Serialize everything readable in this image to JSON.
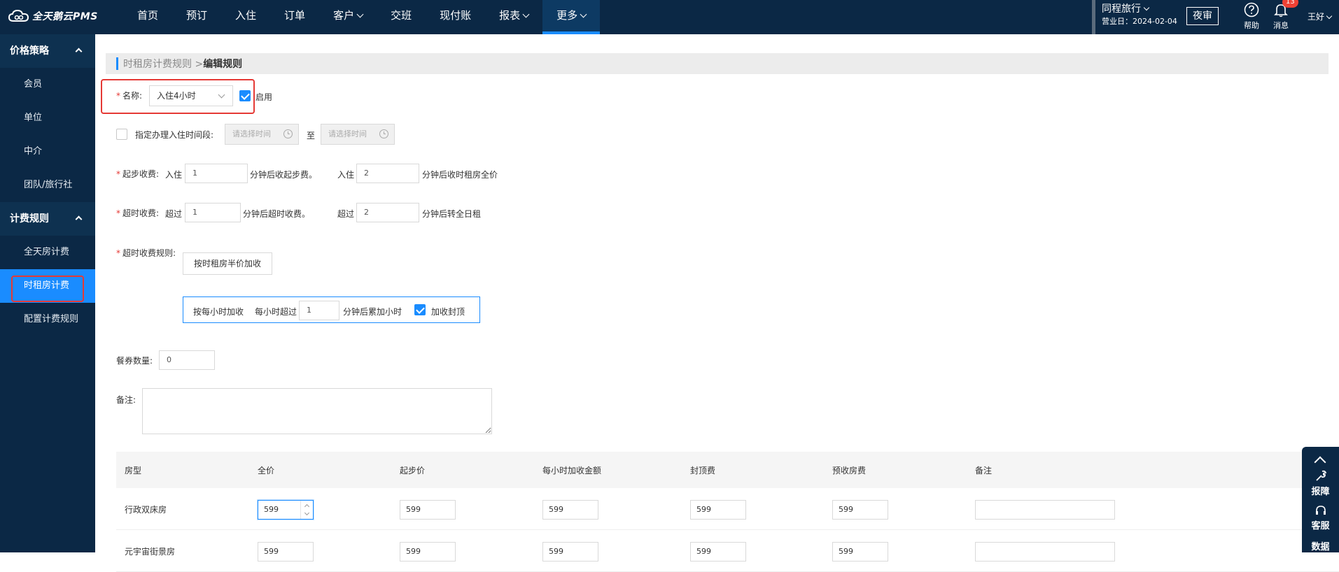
{
  "brand": {
    "name": "全天鹅云PMS"
  },
  "nav": [
    {
      "label": "首页",
      "has_dropdown": false
    },
    {
      "label": "预订",
      "has_dropdown": false
    },
    {
      "label": "入住",
      "has_dropdown": false
    },
    {
      "label": "订单",
      "has_dropdown": false
    },
    {
      "label": "客户",
      "has_dropdown": true
    },
    {
      "label": "交班",
      "has_dropdown": false
    },
    {
      "label": "现付账",
      "has_dropdown": false
    },
    {
      "label": "报表",
      "has_dropdown": true
    },
    {
      "label": "更多",
      "has_dropdown": true,
      "active": true
    }
  ],
  "header": {
    "hotel_name": "同程旅行",
    "business_date": "营业日：2024-02-04",
    "night_audit": "夜审",
    "help": "帮助",
    "messages": "消息",
    "message_count": "13",
    "user": "王好"
  },
  "sidebar": {
    "groups": [
      {
        "title": "价格策略",
        "items": [
          "会员",
          "单位",
          "中介",
          "团队/旅行社"
        ]
      },
      {
        "title": "计费规则",
        "items": [
          "全天房计费",
          "时租房计费",
          "配置计费规则"
        ]
      }
    ],
    "active_item": "时租房计费"
  },
  "breadcrumb": {
    "parent": "时租房计费规则 >",
    "current": "编辑规则"
  },
  "form": {
    "name_label": "名称:",
    "name_value": "入住4小时",
    "enable_label": "启用",
    "enable_checked": true,
    "checkin_period_label": "指定办理入住时间段:",
    "checkin_period_checked": false,
    "time_placeholder": "请选择时间",
    "to": "至",
    "start_fee_label": "起步收费:",
    "start_prefix_1": "入住",
    "start_value_1": "1",
    "start_suffix_1": "分钟后收起步费。",
    "start_prefix_2": "入住",
    "start_value_2": "2",
    "start_suffix_2": "分钟后收时租房全价",
    "overtime_label": "超时收费:",
    "over_prefix_1": "超过",
    "over_value_1": "1",
    "over_suffix_1": "分钟后超时收费。",
    "over_prefix_2": "超过",
    "over_value_2": "2",
    "over_suffix_2": "分钟后转全日租",
    "overtime_rule_label": "超时收费规则:",
    "rule_half_price": "按时租房半价加收",
    "rule_hourly": "按每小时加收",
    "rule_hour_prefix": "每小时超过",
    "rule_hour_value": "1",
    "rule_hour_suffix": "分钟后累加小时",
    "cap_label": "加收封顶",
    "cap_checked": true,
    "meal_label": "餐券数量:",
    "meal_value": "0",
    "note_label": "备注:"
  },
  "table": {
    "columns": [
      "房型",
      "全价",
      "起步价",
      "每小时加收金额",
      "封顶费",
      "预收房费",
      "备注"
    ],
    "rows": [
      {
        "room_type": "行政双床房",
        "full": "599",
        "start": "599",
        "hourly": "599",
        "cap": "599",
        "prepay": "599",
        "note": ""
      },
      {
        "room_type": "元宇宙街景房",
        "full": "599",
        "start": "599",
        "hourly": "599",
        "cap": "599",
        "prepay": "599",
        "note": ""
      }
    ]
  },
  "float_panel": {
    "items": [
      "报障",
      "客服",
      "数据"
    ]
  }
}
